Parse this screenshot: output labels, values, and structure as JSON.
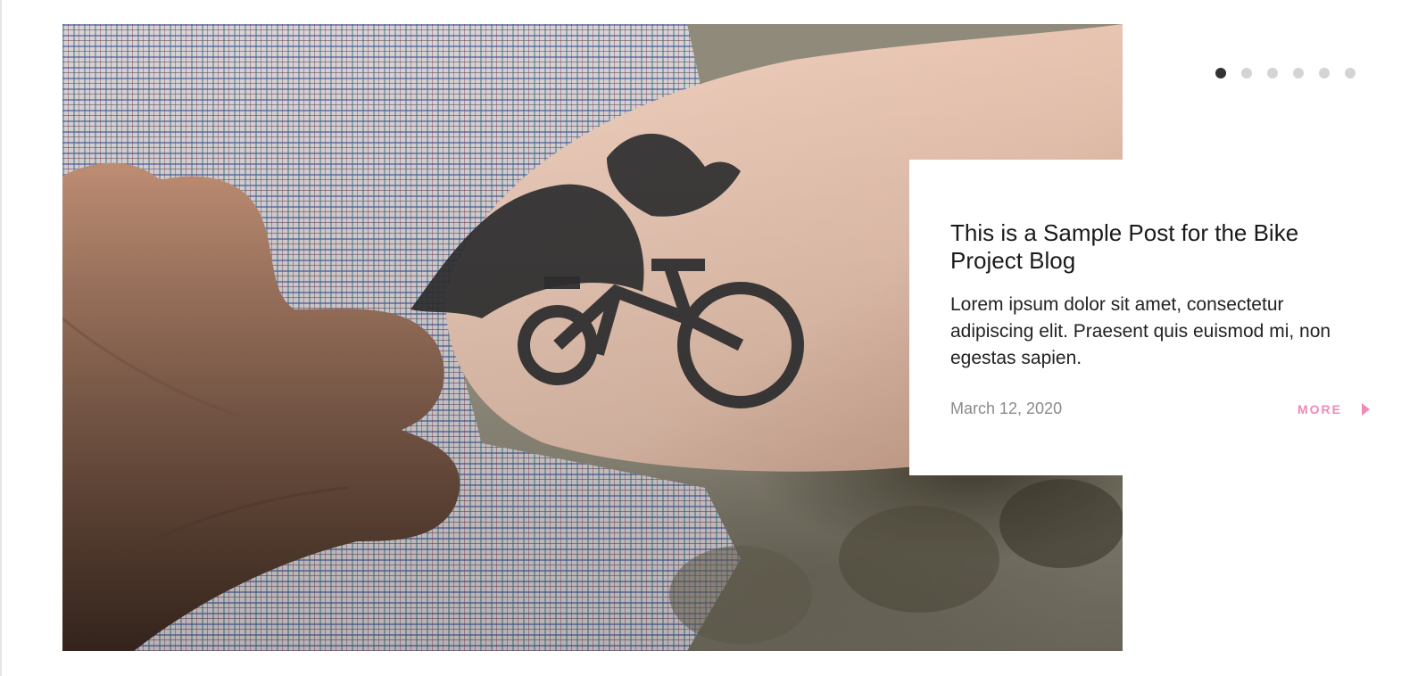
{
  "carousel": {
    "slide_count": 6,
    "active_index": 0
  },
  "post": {
    "title": "This is a Sample Post for the Bike Project Blog",
    "excerpt": "Lorem ipsum dolor sit amet, consectetur adipiscing elit. Praesent quis euismod mi, non egestas sapien.",
    "date": "March 12, 2020",
    "more_label": "MORE"
  },
  "hero_image": {
    "subject": "arm-with-bicycle-tattoo"
  },
  "colors": {
    "accent": "#f08ab8",
    "dot_active": "#333333",
    "dot_inactive": "#d4d4d4",
    "text_primary": "#1a1a1a",
    "text_muted": "#8a8a8a"
  },
  "icons": {
    "more": "caret-right-icon"
  }
}
